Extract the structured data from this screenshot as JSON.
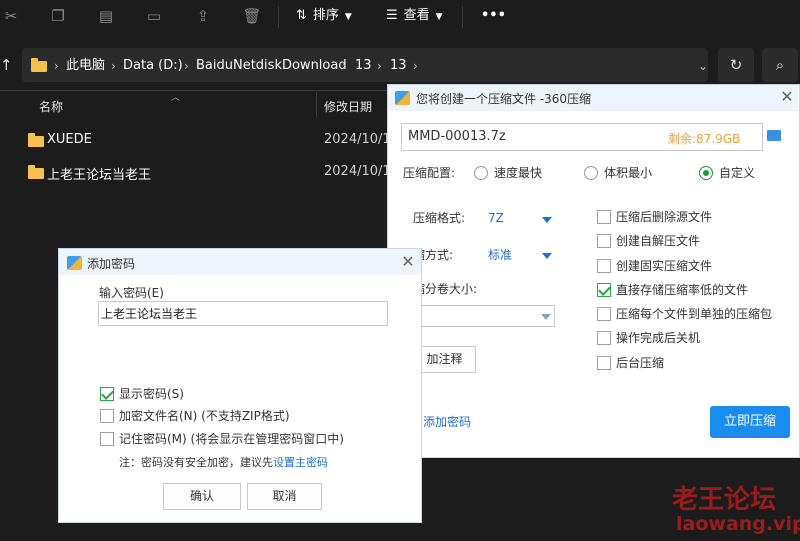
{
  "explorer": {
    "toolbar": {
      "icons": [
        "cut-icon",
        "copy-icon",
        "paste-icon",
        "rename-icon",
        "share-icon",
        "delete-icon"
      ],
      "sort_label": "排序",
      "view_label": "查看",
      "more_label": "•••"
    },
    "breadcrumb": [
      "此电脑",
      "Data (D:)",
      "BaiduNetdiskDownload",
      "13",
      "13"
    ],
    "columns": {
      "name": "名称",
      "modified": "修改日期"
    },
    "rows": [
      {
        "name": "XUEDE",
        "modified": "2024/10/1"
      },
      {
        "name": "上老王论坛当老王",
        "modified": "2024/10/1"
      }
    ]
  },
  "compress_dialog": {
    "title": "您将创建一个压缩文件 -360压缩",
    "filename": "MMD-00013.7z",
    "free_space": "剩余:87.9GB",
    "config_label": "压缩配置:",
    "options": [
      {
        "label": "速度最快",
        "selected": false
      },
      {
        "label": "体积最小",
        "selected": false
      },
      {
        "label": "自定义",
        "selected": true
      }
    ],
    "format_label": "压缩格式:",
    "format_value": "7Z",
    "method_label": "缩方式:",
    "method_value": "标准",
    "split_label": "缩分卷大小:",
    "comment_button": "加注释",
    "add_password_link": "添加密码",
    "start_button": "立即压缩",
    "checkboxes": [
      {
        "label": "压缩后删除源文件",
        "checked": false
      },
      {
        "label": "创建自解压文件",
        "checked": false
      },
      {
        "label": "创建固实压缩文件",
        "checked": false
      },
      {
        "label": "直接存储压缩率低的文件",
        "checked": true
      },
      {
        "label": "压缩每个文件到单独的压缩包",
        "checked": false
      },
      {
        "label": "操作完成后关机",
        "checked": false
      },
      {
        "label": "后台压缩",
        "checked": false
      }
    ]
  },
  "password_dialog": {
    "title": "添加密码",
    "input_label": "输入密码(E)",
    "input_value": "上老王论坛当老王",
    "show_password": {
      "label": "显示密码(S)",
      "checked": true
    },
    "encrypt_names": {
      "label": "加密文件名(N) (不支持ZIP格式)",
      "checked": false
    },
    "remember": {
      "label": "记住密码(M) (将会显示在管理密码窗口中)",
      "checked": false
    },
    "note": "注：密码没有安全加密，建议先",
    "note_link": "设置主密码",
    "ok_button": "确认",
    "cancel_button": "取消"
  },
  "watermark": {
    "title": "老王论坛",
    "url": "laowang.vip"
  },
  "colors": {
    "accent": "#1a8cf0",
    "free_space": "#e8a23a",
    "check_green": "#2fa24a",
    "watermark": "#9b1c1c"
  }
}
